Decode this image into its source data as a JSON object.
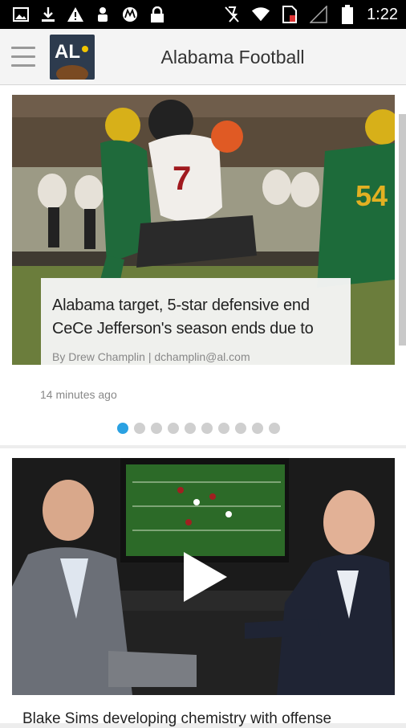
{
  "statusbar": {
    "time": "1:22",
    "left_icons": [
      "image-icon",
      "download-icon",
      "warning-icon",
      "person-icon",
      "motorola-icon",
      "lock-icon"
    ],
    "right_icons": [
      "mute-icon",
      "wifi-icon",
      "sim-icon",
      "signal-icon",
      "battery-icon"
    ]
  },
  "appbar": {
    "title": "Alabama Football",
    "logo_text": "AL",
    "menu_icon": "hamburger-icon"
  },
  "featured": {
    "headline": "Alabama target, 5-star defensive end CeCe Jefferson's season ends due to",
    "byline": "By Drew Champlin | dchamplin@al.com",
    "timestamp": "14 minutes ago",
    "carousel_count": 10,
    "carousel_active": 0
  },
  "video_story": {
    "title": "Blake Sims developing chemistry with offense",
    "play_icon": "play-icon"
  },
  "colors": {
    "accent": "#2aa1e2",
    "statusbar": "#000000",
    "appbar": "#f4f4f4",
    "logo_bg": "#2d3b4e"
  }
}
